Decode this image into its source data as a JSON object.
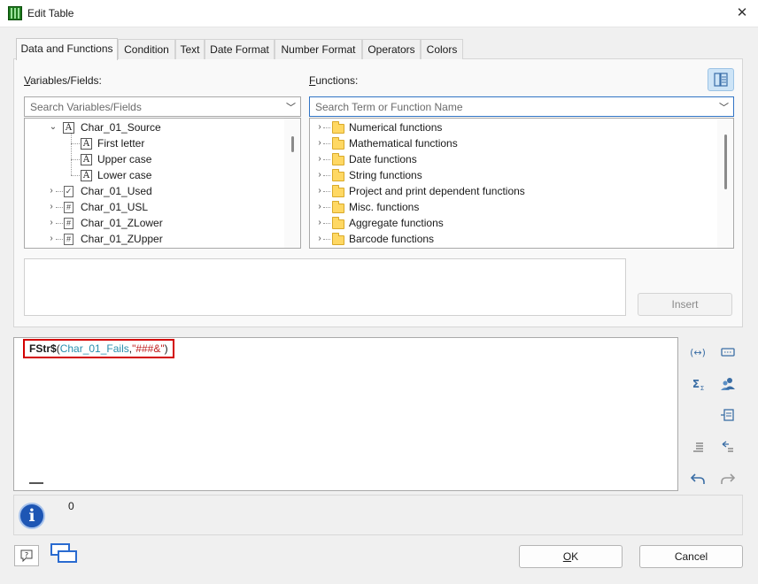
{
  "window": {
    "title": "Edit Table",
    "close": "✕"
  },
  "tabs": [
    {
      "label": "Data and Functions",
      "active": true
    },
    {
      "label": "Condition"
    },
    {
      "label": "Text"
    },
    {
      "label": "Date Format"
    },
    {
      "label": "Number Format"
    },
    {
      "label": "Operators"
    },
    {
      "label": "Colors"
    }
  ],
  "variables": {
    "label_accel": "V",
    "label_rest": "ariables/Fields:",
    "search_placeholder": "Search Variables/Fields",
    "items": [
      {
        "label": "Char_01_Source",
        "icon": "A"
      },
      {
        "label": "First letter",
        "icon": "A"
      },
      {
        "label": "Upper case",
        "icon": "A"
      },
      {
        "label": "Lower case",
        "icon": "A"
      },
      {
        "label": "Char_01_Used",
        "icon": "check-doc"
      },
      {
        "label": "Char_01_USL",
        "icon": "number-doc"
      },
      {
        "label": "Char_01_ZLower",
        "icon": "number-doc"
      },
      {
        "label": "Char_01_ZUpper",
        "icon": "number-doc"
      }
    ]
  },
  "functions": {
    "label_accel": "F",
    "label_rest": "unctions:",
    "search_placeholder": "Search Term or Function Name",
    "items": [
      {
        "label": "Numerical functions"
      },
      {
        "label": "Mathematical functions"
      },
      {
        "label": "Date functions"
      },
      {
        "label": "String functions"
      },
      {
        "label": "Project and print dependent functions"
      },
      {
        "label": "Misc. functions"
      },
      {
        "label": "Aggregate functions"
      },
      {
        "label": "Barcode functions"
      }
    ]
  },
  "insert_button": "Insert",
  "formula": {
    "name": "FStr$",
    "open": "(",
    "field": "Char_01_Fails",
    "comma": ",",
    "string": "\"###&\"",
    "close": ")"
  },
  "result": {
    "value": "0"
  },
  "buttons": {
    "ok_accel": "O",
    "ok_rest": "K",
    "cancel": "Cancel",
    "help": "?"
  },
  "colors": {
    "accent": "#3174c5",
    "highlight": "#d30000",
    "field": "#2a8fae",
    "string": "#c02020"
  }
}
